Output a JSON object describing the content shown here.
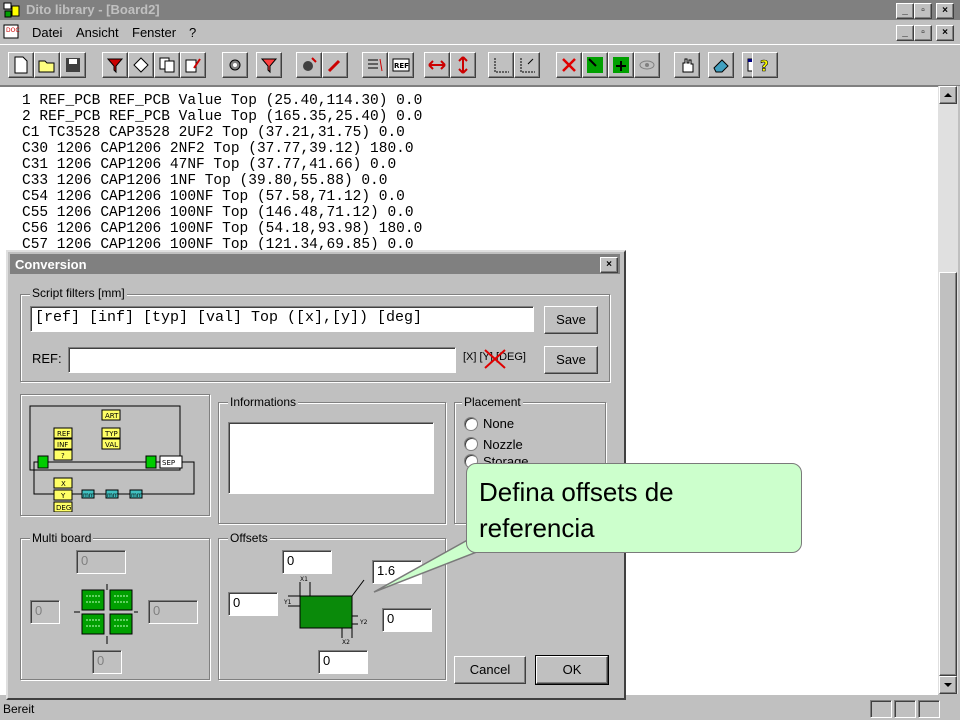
{
  "window": {
    "title": "Dito library - [Board2]",
    "buttons": [
      "_",
      "▫",
      "×"
    ]
  },
  "menu": {
    "items": [
      "Datei",
      "Ansicht",
      "Fenster",
      "?"
    ]
  },
  "document": {
    "lines": [
      "1 REF_PCB REF_PCB Value Top (25.40,114.30) 0.0",
      "2 REF_PCB REF_PCB Value Top (165.35,25.40) 0.0",
      "C1 TC3528 CAP3528 2UF2 Top (37.21,31.75) 0.0",
      "C30 1206 CAP1206 2NF2 Top (37.77,39.12) 180.0",
      "C31 1206 CAP1206 47NF Top (37.77,41.66) 0.0",
      "C33 1206 CAP1206 1NF Top (39.80,55.88) 0.0",
      "C54 1206 CAP1206 100NF Top (57.58,71.12) 0.0",
      "C55 1206 CAP1206 100NF Top (146.48,71.12) 0.0",
      "C56 1206 CAP1206 100NF Top (54.18,93.98) 180.0",
      "C57 1206 CAP1206 100NF Top (121.34,69.85) 0.0"
    ]
  },
  "status": {
    "text": "Bereit"
  },
  "dialog": {
    "title": "Conversion",
    "script_filters": {
      "label": "Script filters [mm]",
      "value": "[ref] [inf] [typ] [val] Top ([x],[y]) [deg]",
      "save_label": "Save",
      "ref_label": "REF:",
      "ref_value": "",
      "ref_hint": "[X] [Y] [DEG]",
      "ref_save_label": "Save"
    },
    "diagram_labels": {
      "art": "ART",
      "typ": "TYP",
      "val": "VAL",
      "ref": "REF",
      "inf": "INF",
      "q": "?",
      "sep": "SEP",
      "x": "X",
      "y": "Y",
      "deg": "DEG",
      "mm": "mm"
    },
    "informations": {
      "label": "Informations",
      "value": ""
    },
    "placement": {
      "label": "Placement",
      "options": [
        "None",
        "Nozzle",
        "Storage"
      ]
    },
    "multi_board": {
      "label": "Multi board",
      "top": "0",
      "left": "0",
      "right": "0",
      "bottom": "0"
    },
    "offsets": {
      "label": "Offsets",
      "top": "0",
      "angle": "1.6",
      "left": "0",
      "right": "0",
      "bottom": "0",
      "dim_labels": {
        "x1": "X1",
        "y1": "Y1",
        "y2": "Y2",
        "x2": "X2"
      }
    },
    "cancel_label": "Cancel",
    "ok_label": "OK"
  },
  "callout": {
    "line1": "Defina offsets de",
    "line2": "referencia"
  },
  "colors": {
    "callout_bg": "#ccffcc",
    "title_inactive": "#808080",
    "diagram_yellow": "#ffff66",
    "diagram_green": "#00cc00",
    "board_green": "#0a8a0a"
  }
}
